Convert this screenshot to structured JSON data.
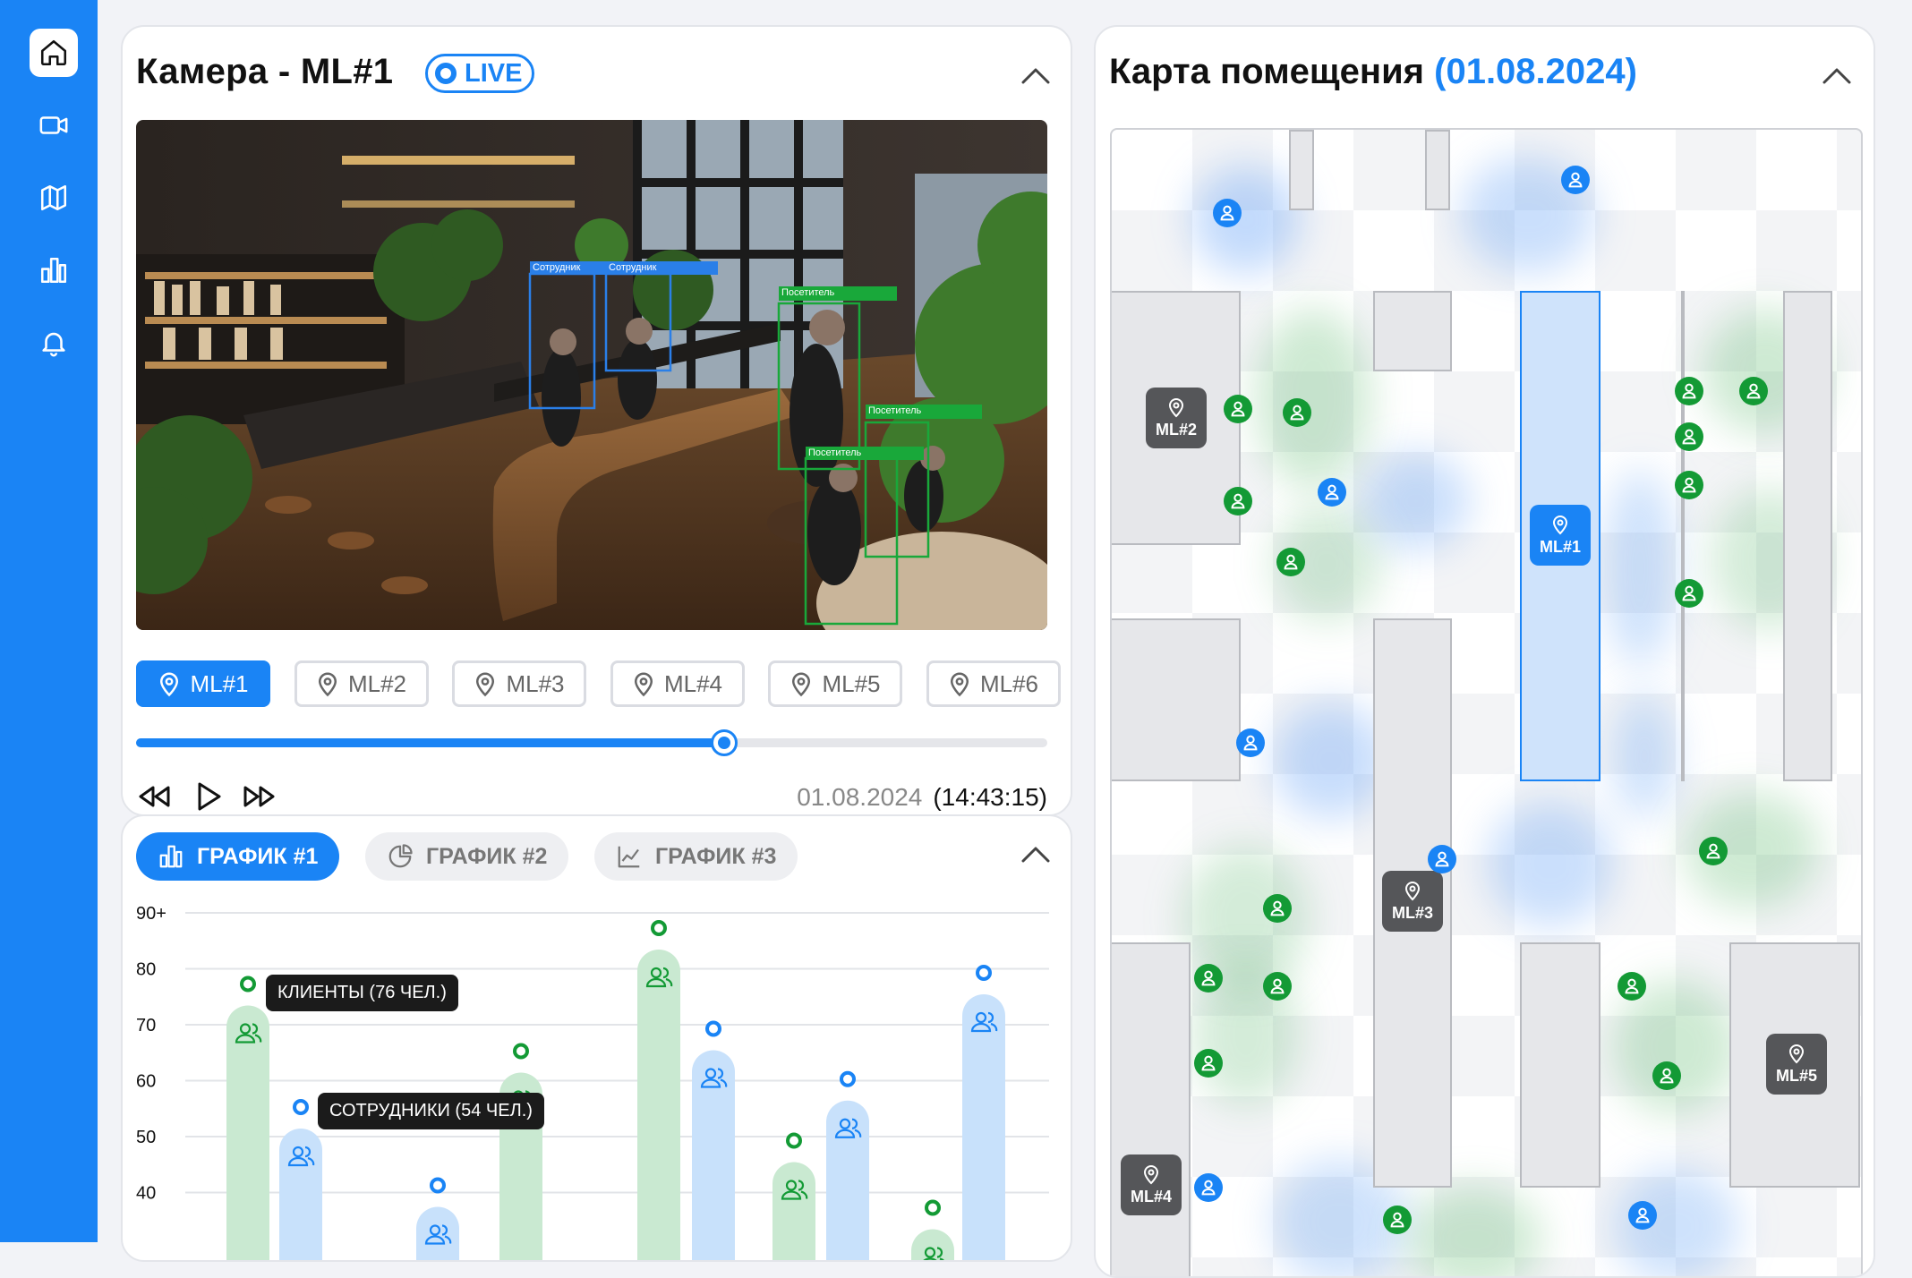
{
  "sidebar": {
    "items": [
      {
        "icon": "home-icon",
        "active": true
      },
      {
        "icon": "video-camera-icon",
        "active": false
      },
      {
        "icon": "map-icon",
        "active": false
      },
      {
        "icon": "bar-chart-icon",
        "active": false
      },
      {
        "icon": "bell-icon",
        "active": false
      }
    ]
  },
  "camera": {
    "title": "Камера - ML#1",
    "live_label": "LIVE",
    "detections": [
      {
        "label": "Сотрудник",
        "type": "employee"
      },
      {
        "label": "Сотрудник",
        "type": "employee"
      },
      {
        "label": "Посетитель",
        "type": "visitor"
      },
      {
        "label": "Посетитель",
        "type": "visitor"
      },
      {
        "label": "Посетитель",
        "type": "visitor"
      }
    ],
    "tabs": [
      {
        "label": "ML#1",
        "active": true
      },
      {
        "label": "ML#2",
        "active": false
      },
      {
        "label": "ML#3",
        "active": false
      },
      {
        "label": "ML#4",
        "active": false
      },
      {
        "label": "ML#5",
        "active": false
      },
      {
        "label": "ML#6",
        "active": false
      }
    ],
    "progress": 0.645,
    "date": "01.08.2024",
    "time": "(14:43:15)"
  },
  "charts": {
    "tabs": [
      {
        "label": "ГРАФИК #1",
        "icon": "bar-chart-icon",
        "active": true
      },
      {
        "label": "ГРАФИК #2",
        "icon": "pie-chart-icon",
        "active": false
      },
      {
        "label": "ГРАФИК #3",
        "icon": "line-chart-icon",
        "active": false
      }
    ],
    "tooltip_clients": "КЛИЕНТЫ (76 ЧЕЛ.)",
    "tooltip_staff": "СОТРУДНИКИ (54 ЧЕЛ.)"
  },
  "chart_data": {
    "type": "bar",
    "y_ticks": [
      "90+",
      "80",
      "70",
      "60",
      "50",
      "40"
    ],
    "ylim": [
      30,
      90
    ],
    "series": [
      {
        "color": "#c9e9d1",
        "marker": "#139a35",
        "values": [
          76,
          64,
          86,
          48,
          null,
          36
        ]
      },
      {
        "color": "#c8e1fb",
        "marker": "#1a84f5",
        "values": [
          54,
          40,
          68,
          59,
          78
        ]
      }
    ],
    "groups": [
      {
        "clients": 76,
        "staff": 54
      },
      {
        "clients": null,
        "staff": 40
      },
      {
        "clients": 64,
        "staff": null
      },
      {
        "clients": 86,
        "staff": 68
      },
      {
        "clients": 48,
        "staff": 59
      },
      {
        "clients": 36,
        "staff": 78
      }
    ]
  },
  "map": {
    "title": "Карта помещения",
    "date": "(01.08.2024)",
    "cameras": [
      "ML#1",
      "ML#2",
      "ML#3",
      "ML#4",
      "ML#5"
    ],
    "colors": {
      "client": "#139a35",
      "staff": "#1a84f5"
    }
  }
}
